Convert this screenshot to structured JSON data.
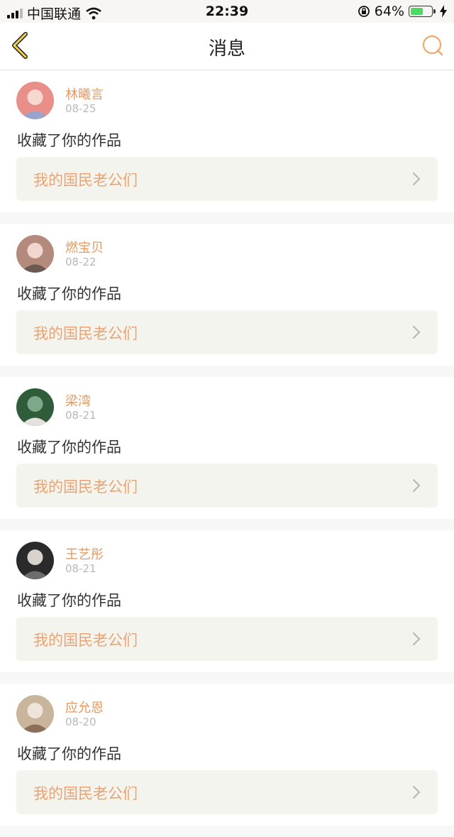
{
  "status_bar": {
    "carrier": "中国联通",
    "time": "22:39",
    "battery_percent": "64%",
    "battery_level": 0.64,
    "icons": [
      "signal-icon",
      "wifi-icon",
      "rotation-lock-icon",
      "battery-icon",
      "charging-icon"
    ]
  },
  "nav": {
    "title": "消息",
    "back_icon": "chevron-left-icon",
    "search_icon": "search-icon",
    "accent_color": "#f0a96b"
  },
  "messages": [
    {
      "user": "林曦言",
      "date": "08-25",
      "text": "收藏了你的作品",
      "work": "我的国民老公们",
      "avatar_colors": [
        "#e98f8a",
        "#f6d8d0",
        "#9aa3c9"
      ]
    },
    {
      "user": "燃宝贝",
      "date": "08-22",
      "text": "收藏了你的作品",
      "work": "我的国民老公们",
      "avatar_colors": [
        "#b48a7c",
        "#f0d6cf",
        "#6b5a54"
      ]
    },
    {
      "user": "梁湾",
      "date": "08-21",
      "text": "收藏了你的作品",
      "work": "我的国民老公们",
      "avatar_colors": [
        "#2f5d3a",
        "#7fa98a",
        "#e6e1dc"
      ]
    },
    {
      "user": "王艺彤",
      "date": "08-21",
      "text": "收藏了你的作品",
      "work": "我的国民老公们",
      "avatar_colors": [
        "#2a2a2a",
        "#d7d2cc",
        "#6d6d6d"
      ]
    },
    {
      "user": "应允恩",
      "date": "08-20",
      "text": "收藏了你的作品",
      "work": "我的国民老公们",
      "avatar_colors": [
        "#c9b49c",
        "#efe4da",
        "#8b6f58"
      ]
    }
  ]
}
